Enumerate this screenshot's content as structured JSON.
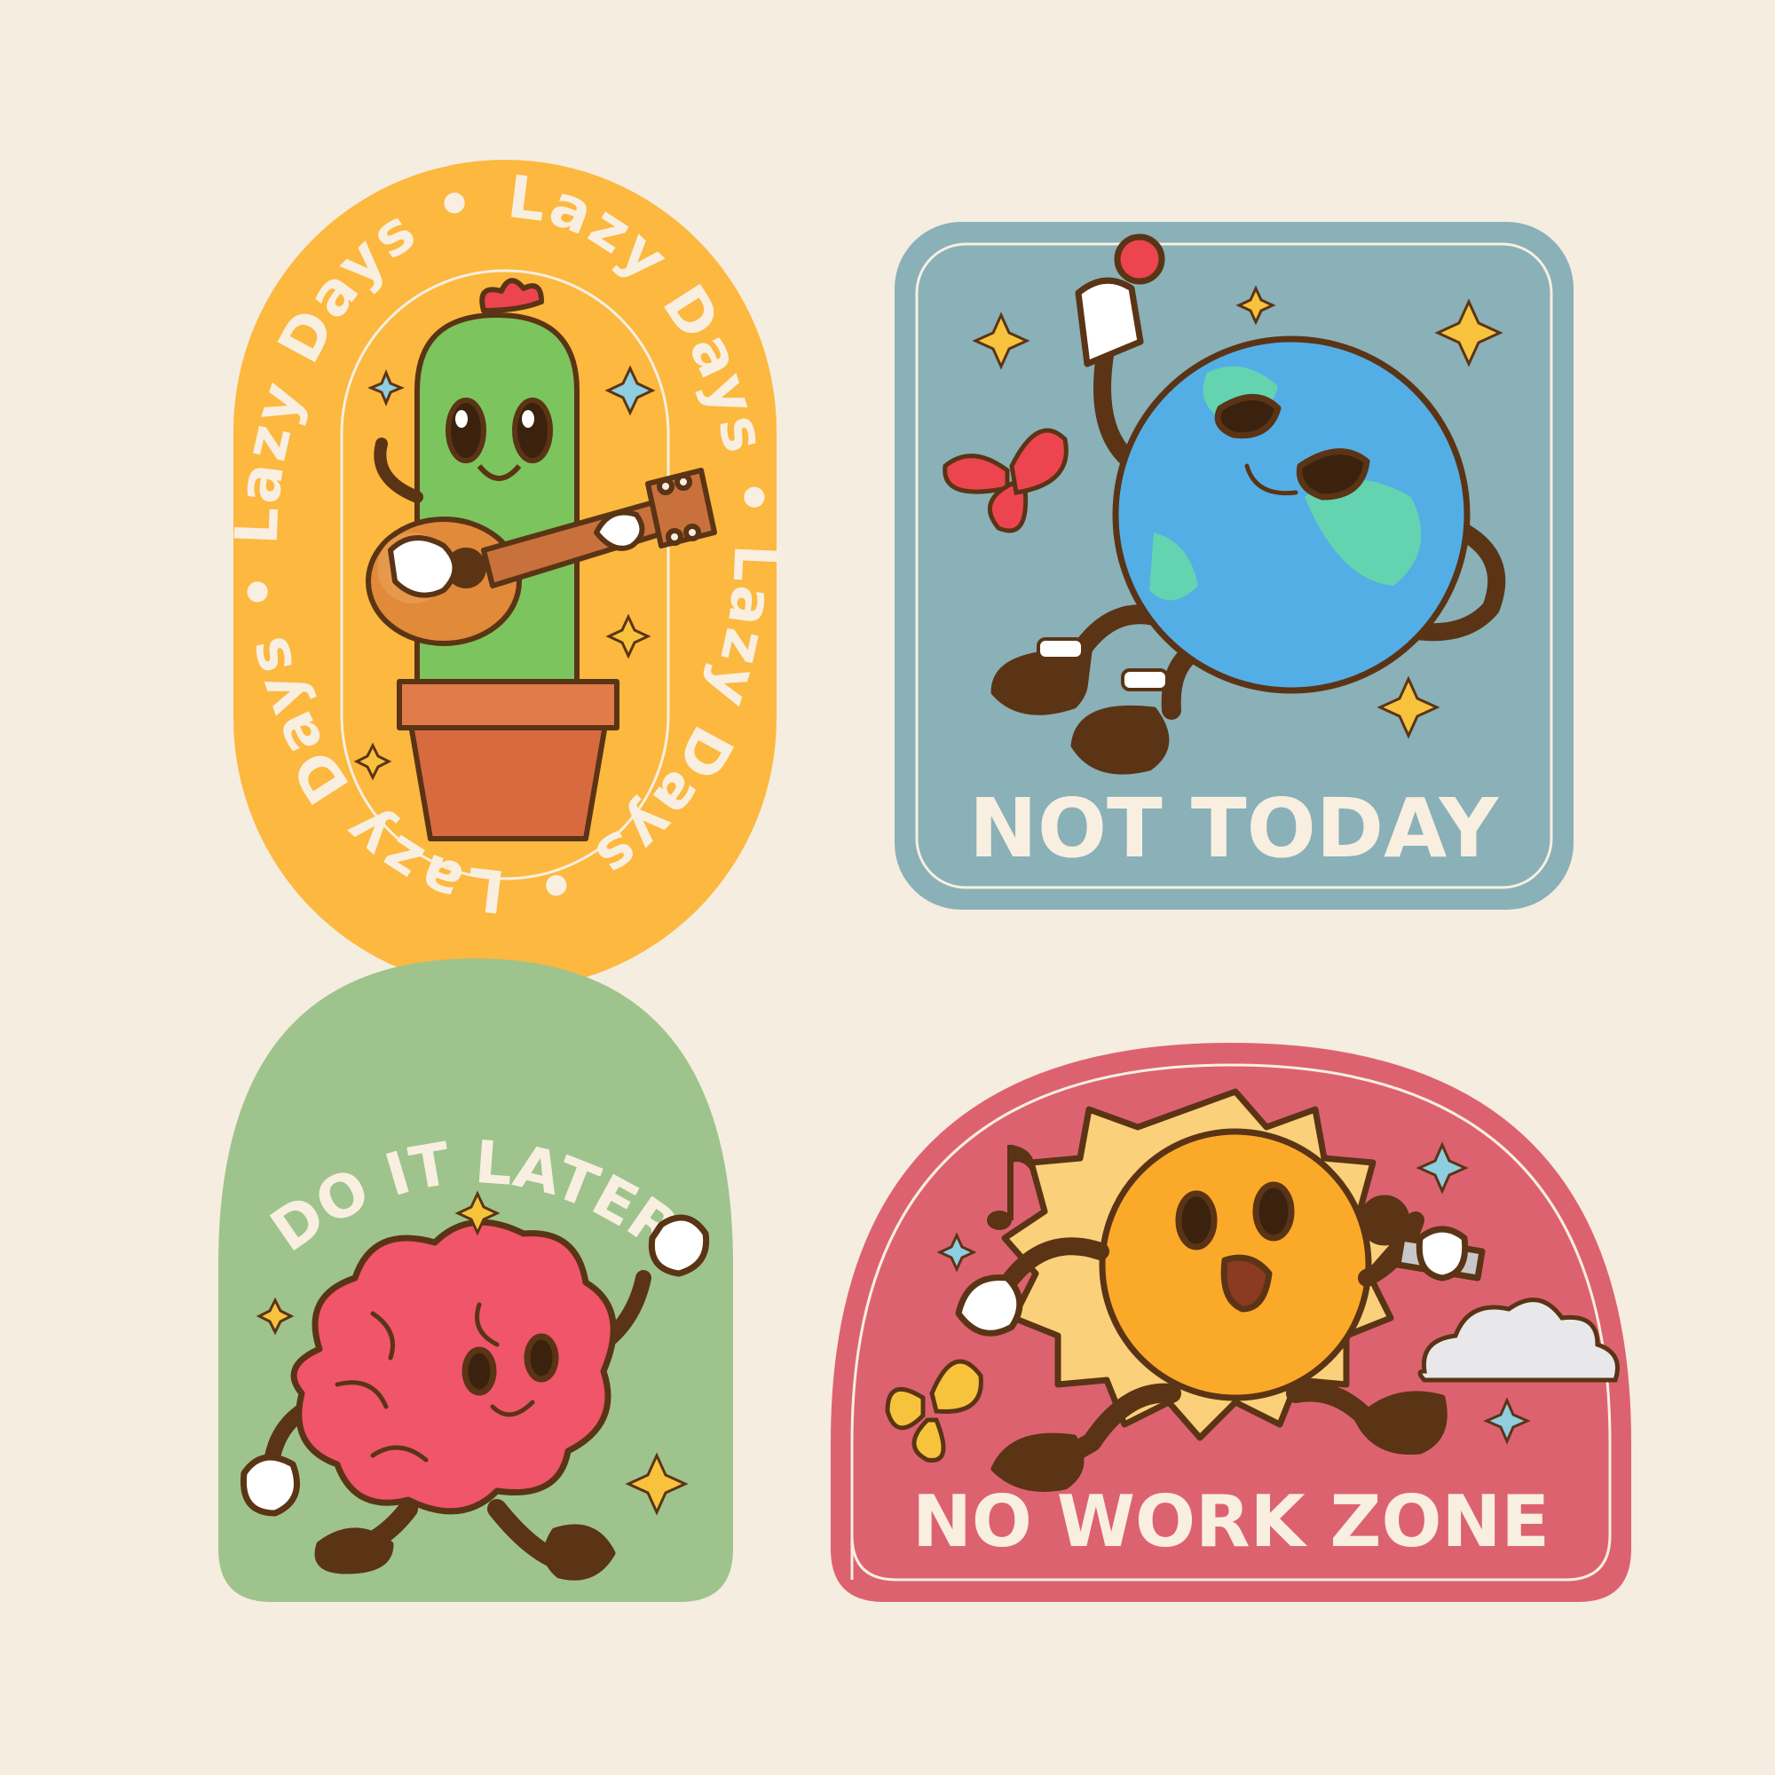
{
  "colors": {
    "background": "#f5ede0",
    "cream": "#f8efe1",
    "outline": "#5a3415",
    "yellow_badge": "#fcb83f",
    "blue_badge": "#8ab0b8",
    "green_badge": "#9fc38c",
    "pink_badge": "#dd6270",
    "cactus_green": "#7cc45e",
    "pot_orange": "#d86a3f",
    "earth_blue": "#54aee6",
    "earth_green": "#64d3b0",
    "brain_pink": "#f0556a",
    "sun_orange": "#fba928",
    "sparkle_yellow": "#f8c33c",
    "sparkle_blue": "#8fcde0",
    "butterfly_red": "#ec4550"
  },
  "stickers": {
    "lazy_days": {
      "ring_text": "Lazy Days • Lazy Days • Lazy Days • Lazy Days • ",
      "character": "cactus-playing-guitar"
    },
    "not_today": {
      "text": "NOT TODAY",
      "character": "earth-holding-ball"
    },
    "do_it_later": {
      "text": "DO IT LATER",
      "character": "walking-brain"
    },
    "no_work_zone": {
      "text": "NO WORK ZONE",
      "character": "singing-sun"
    }
  }
}
